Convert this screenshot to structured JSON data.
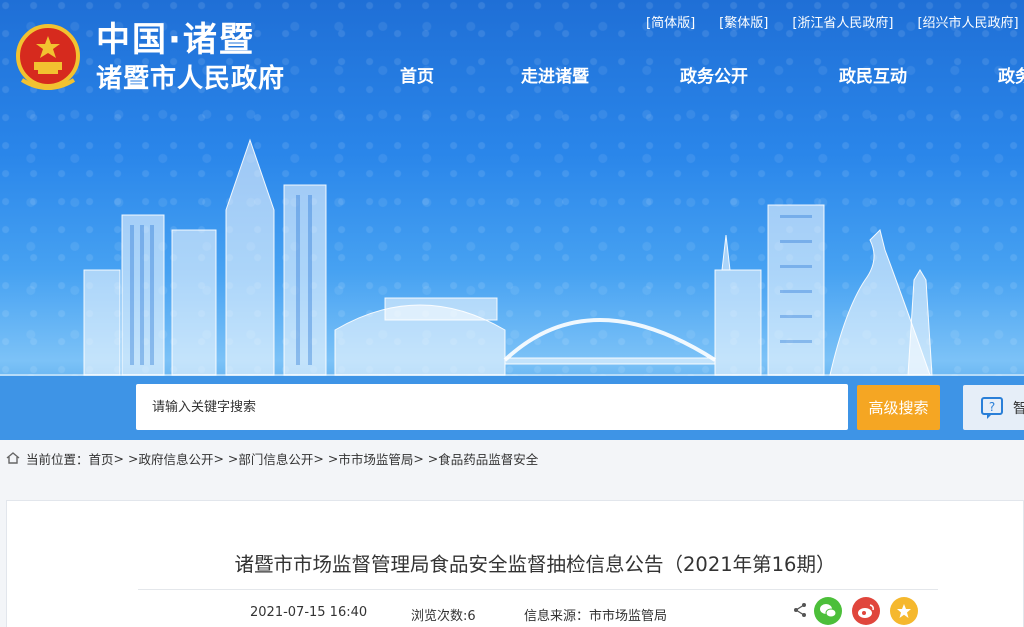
{
  "site": {
    "title_top": "中国·诸暨",
    "title_main": "诸暨市人民政府"
  },
  "lang_links": [
    "[简体版]",
    "[繁体版]",
    "[浙江省人民政府]",
    "[绍兴市人民政府]"
  ],
  "nav": [
    "首页",
    "走进诸暨",
    "政务公开",
    "政民互动",
    "政务服"
  ],
  "search": {
    "placeholder": "请输入关键字搜索",
    "advanced_label": "高级搜索",
    "smart_label": "智"
  },
  "breadcrumb": {
    "label": "当前位置：",
    "items": [
      "首页",
      "政府信息公开",
      "部门信息公开",
      "市市场监管局",
      "食品药品监督安全"
    ],
    "sep": " > > "
  },
  "article": {
    "title": "诸暨市市场监督管理局食品安全监督抽检信息公告（2021年第16期）",
    "datetime": "2021-07-15 16:40",
    "views": "浏览次数:6",
    "source": "信息来源：市市场监管局"
  },
  "colors": {
    "accent": "#f5a623",
    "wechat": "#4cbf3a",
    "weibo": "#e0463c",
    "favorite": "#f5b82e"
  }
}
